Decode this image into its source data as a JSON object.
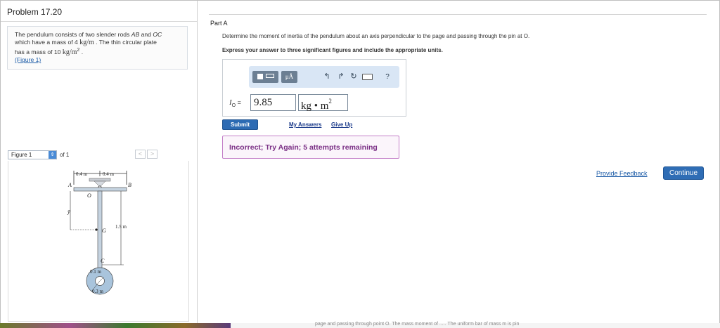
{
  "problem": {
    "title": "Problem 17.20",
    "statement_line1": "The pendulum consists of two slender rods ",
    "rod_ab": "AB",
    "and": " and ",
    "rod_oc": "OC",
    "statement_line2": "which have a mass of 4 ",
    "rod_mass_unit": "kg/m",
    "statement_line3": " . The thin circular plate",
    "statement_line4": "has a mass of 10 ",
    "plate_mass_unit": "kg/m",
    "plate_mass_exp": "2",
    "period": " .",
    "figure_link": "(Figure 1)"
  },
  "figure": {
    "select_label": "Figure 1",
    "of_label": "of 1",
    "prev": "<",
    "next": ">",
    "labels": {
      "dim_left": "0.4 m",
      "dim_right": "0.4 m",
      "point_a": "A",
      "point_b": "B",
      "point_o": "O",
      "point_g": "G",
      "point_c": "C",
      "ybar": "ȳ",
      "length": "1.5 m",
      "inner_r": "0.1 m",
      "outer_r": "0.3 m"
    }
  },
  "part": {
    "title": "Part A",
    "question": "Determine the moment of inertia of the pendulum about an axis perpendicular to the page and passing through the pin at O.",
    "instruction": "Express your answer to three significant figures and include the appropriate units.",
    "toolbar": {
      "mu_label": "μÅ",
      "help_label": "?"
    },
    "answer_symbol": "I",
    "answer_sub": "O",
    "equals": "=",
    "value": "9.85",
    "unit_base": "kg • m",
    "unit_exp": "2",
    "submit": "Submit",
    "my_answers": "My Answers",
    "give_up": "Give Up",
    "feedback": "Incorrect; Try Again; 5 attempts remaining"
  },
  "footer": {
    "provide_feedback": "Provide Feedback",
    "continue": "Continue",
    "strip_text": "page and passing through point O. The mass moment of ..... The uniform bar of mass m is pin"
  },
  "colors": {
    "accent_blue": "#2d6bb3",
    "feedback_border": "#c37ec8",
    "feedback_text": "#7a2f85",
    "toolbar_bg": "#d9e6f5"
  }
}
